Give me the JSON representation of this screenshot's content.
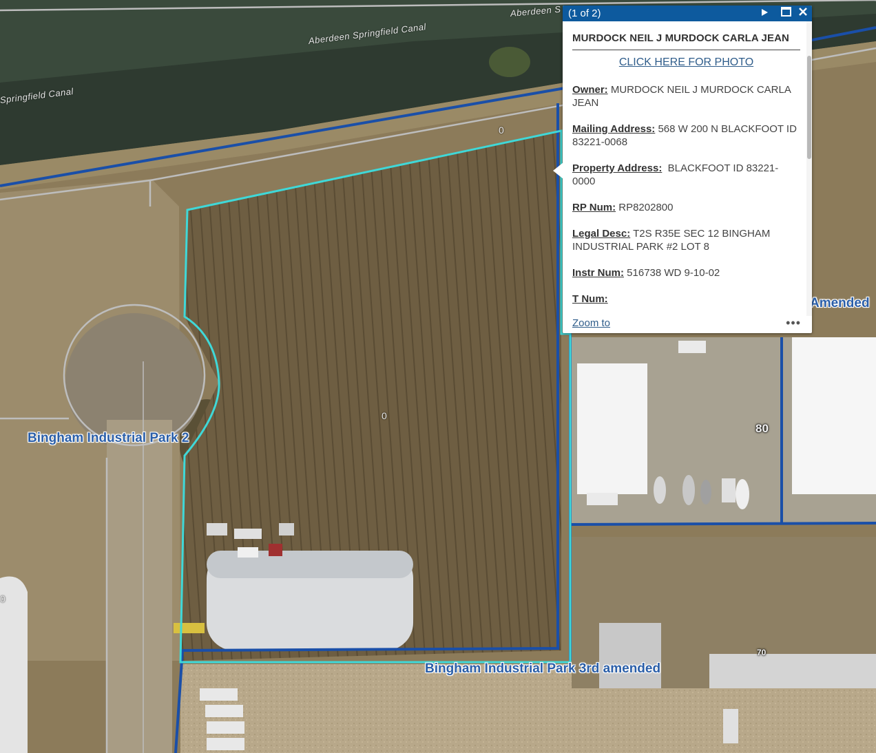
{
  "map": {
    "labels": {
      "canal_1": "Aberdeen Springfield Canal",
      "canal_2": "Springfield Canal",
      "canal_3": "Aberdeen S",
      "subdivision_1": "Bingham Industrial Park 2",
      "subdivision_2": "Bingham Industrial Park 3rd amended",
      "subdivision_3": "Amended",
      "lot_1": "0",
      "lot_2": "0",
      "lot_3": "0",
      "address_80": "80",
      "address_70": "70"
    },
    "colors": {
      "selected_parcel": "#3fd8d8",
      "parcel_line": "#1a4fa8",
      "road_line": "#bdbdbd"
    }
  },
  "popup": {
    "count": "(1 of 2)",
    "icons": {
      "next": "next-arrow-icon",
      "maximize": "maximize-icon",
      "close": "close-icon"
    },
    "title": "MURDOCK NEIL J MURDOCK CARLA JEAN",
    "photo_link": "CLICK HERE FOR PHOTO",
    "fields": [
      {
        "label": "Owner:",
        "value": "MURDOCK NEIL J MURDOCK CARLA JEAN"
      },
      {
        "label": "Mailing Address:",
        "value": "568 W 200 N BLACKFOOT ID 83221-0068"
      },
      {
        "label": "Property Address:",
        "value": " BLACKFOOT ID 83221-0000"
      },
      {
        "label": "RP Num:",
        "value": "RP8202800"
      },
      {
        "label": "Legal Desc:",
        "value": "T2S R35E SEC 12 BINGHAM INDUSTRIAL PARK #2 LOT 8"
      },
      {
        "label": "Instr Num:",
        "value": "516738 WD 9-10-02"
      },
      {
        "label": "T Num:",
        "value": ""
      }
    ],
    "zoom_to": "Zoom to",
    "more": "•••",
    "header_color": "#0d5a9e"
  }
}
